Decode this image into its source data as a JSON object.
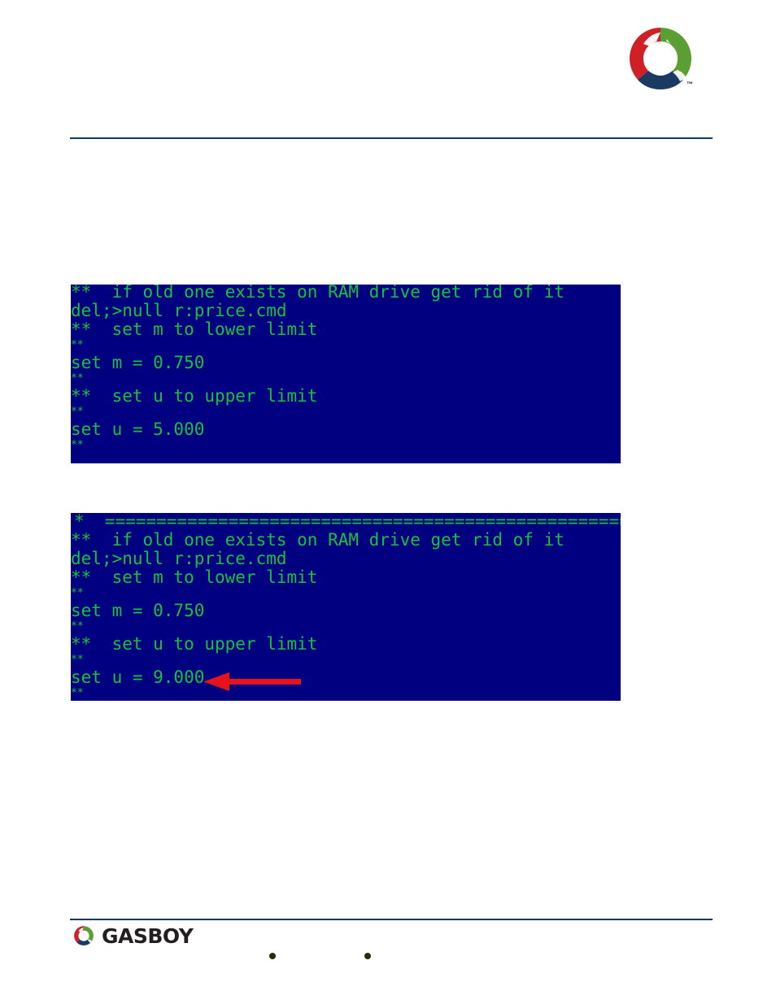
{
  "header": {
    "logo_name": "gasboy-circle-logo",
    "trademark": "™",
    "colors": {
      "red": "#cf2027",
      "green": "#5a9e34",
      "navy": "#1a3a63"
    }
  },
  "terminals": [
    {
      "name": "terminal-screenshot-upper",
      "background": "#000080",
      "text_color": "#16c23c",
      "lines": [
        {
          "text": "  ------------------------------------------------------",
          "size": "rule"
        },
        {
          "text": "**  if old one exists on RAM drive get rid of it",
          "size": "big"
        },
        {
          "text": "del;>null r:price.cmd",
          "size": "big"
        },
        {
          "text": "**  set m to lower limit",
          "size": "big"
        },
        {
          "text": "**",
          "size": "small"
        },
        {
          "text": "set m = 0.750",
          "size": "big"
        },
        {
          "text": "**",
          "size": "small"
        },
        {
          "text": "**  set u to upper limit",
          "size": "big"
        },
        {
          "text": "**",
          "size": "small"
        },
        {
          "text": "set u = 5.000",
          "size": "big"
        },
        {
          "text": "**",
          "size": "small"
        }
      ]
    },
    {
      "name": "terminal-screenshot-lower",
      "background": "#000080",
      "text_color": "#16c23c",
      "lines": [
        {
          "text": "*  =====================================================",
          "size": "big"
        },
        {
          "text": "**  if old one exists on RAM drive get rid of it",
          "size": "big"
        },
        {
          "text": "del;>null r:price.cmd",
          "size": "big"
        },
        {
          "text": "**  set m to lower limit",
          "size": "big"
        },
        {
          "text": "**",
          "size": "small"
        },
        {
          "text": "set m = 0.750",
          "size": "big"
        },
        {
          "text": "**",
          "size": "small"
        },
        {
          "text": "**  set u to upper limit",
          "size": "big"
        },
        {
          "text": "**",
          "size": "small"
        },
        {
          "text": "set u = 9.000",
          "size": "big"
        },
        {
          "text": "**",
          "size": "small"
        }
      ]
    }
  ],
  "annotation": {
    "name": "red-arrow-pointing-to-set-u",
    "color": "#e8131a",
    "direction": "left",
    "points_at": "set u = 9.000"
  },
  "footer": {
    "wordmark": "GASBOY",
    "logo_name": "gasboy-circle-logo",
    "separator_1": "•",
    "separator_2": "•",
    "text_1": "",
    "text_2": "",
    "text_3": ""
  }
}
